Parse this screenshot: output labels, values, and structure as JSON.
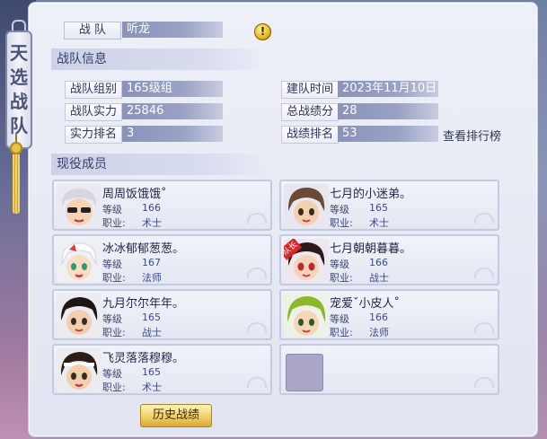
{
  "banner": {
    "chars": [
      "天",
      "选",
      "战",
      "队"
    ]
  },
  "team": {
    "label": "战 队",
    "name": "听龙",
    "info_icon": "exclamation-icon"
  },
  "info_section": {
    "title": "战队信息",
    "group_label": "战队组别",
    "group_value": "165级组",
    "strength_label": "战队实力",
    "strength_value": "25846",
    "strength_rank_label": "实力排名",
    "strength_rank_value": "3",
    "founded_label": "建队时间",
    "founded_value": "2023年11月10日",
    "total_label": "总战绩分",
    "total_value": "28",
    "record_rank_label": "战绩排名",
    "record_rank_value": "53",
    "leaderboard_link": "查看排行榜"
  },
  "members_section": {
    "title": "现役成员",
    "level_label": "等级",
    "job_label": "职业:",
    "captain_badge": "队长",
    "members": [
      {
        "name": "周周饭饿饿˚",
        "level": "166",
        "job": "术士"
      },
      {
        "name": "七月的小迷弟。",
        "level": "165",
        "job": "术士"
      },
      {
        "name": "冰冰郁郁葱葱。",
        "level": "167",
        "job": "法师"
      },
      {
        "name": "七月朝朝暮暮。",
        "level": "166",
        "job": "战士"
      },
      {
        "name": "九月尔尔年年。",
        "level": "165",
        "job": "战士"
      },
      {
        "name": "宠爱ˇ小皮人˚",
        "level": "166",
        "job": "法师"
      },
      {
        "name": "飞灵落落穆穆。",
        "level": "165",
        "job": "术士"
      }
    ]
  },
  "footer": {
    "history_button": "历史战绩"
  },
  "colors": {
    "accent_gold": "#f0cf6a",
    "value_bar": "#8a93b8",
    "captain_red": "#d8262a"
  }
}
